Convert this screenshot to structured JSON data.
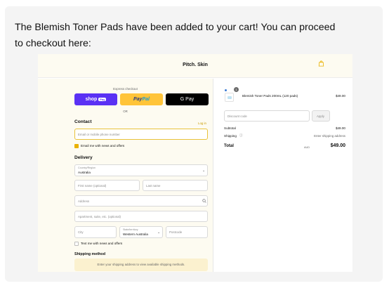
{
  "message": "The Blemish Toner Pads have been added to your cart! You can proceed to checkout here:",
  "shop": {
    "brand": "Pitch. Skin",
    "express_checkout": "Express checkout",
    "shop_pay": {
      "label": "shop",
      "tag": "Pay"
    },
    "paypal": {
      "pay": "Pay",
      "pal": "Pal"
    },
    "gpay": "G Pay",
    "or": "OR",
    "contact": {
      "heading": "Contact",
      "login": "Log in",
      "email_placeholder": "Email or mobile phone number",
      "news_label": "Email me with news and offers",
      "news_checked": true
    },
    "delivery": {
      "heading": "Delivery",
      "country_label": "Country/Region",
      "country_value": "Australia",
      "first_name": "First name (optional)",
      "last_name": "Last name",
      "address": "Address",
      "apartment": "Apartment, suite, etc. (optional)",
      "city": "City",
      "state_label": "State/territory",
      "state_value": "Western Australia",
      "postcode": "Postcode",
      "text_label": "Text me with news and offers",
      "text_checked": false
    },
    "shipping": {
      "heading": "Shipping method",
      "note": "Enter your shipping address to view available shipping methods."
    },
    "summary": {
      "item_name": "Blemish Toner Pads 200mL (120 pads)",
      "item_price": "$49.00",
      "item_qty": "1",
      "discount_placeholder": "Discount code",
      "apply": "Apply",
      "subtotal_label": "Subtotal",
      "subtotal_value": "$49.00",
      "shipping_label": "Shipping",
      "shipping_value": "Enter shipping address",
      "total_label": "Total",
      "currency": "AUD",
      "total_value": "$49.00"
    }
  },
  "colors": {
    "shop_pay": "#5a31f4",
    "paypal": "#ffc439",
    "gpay": "#000000",
    "accent": "#e9b100"
  }
}
